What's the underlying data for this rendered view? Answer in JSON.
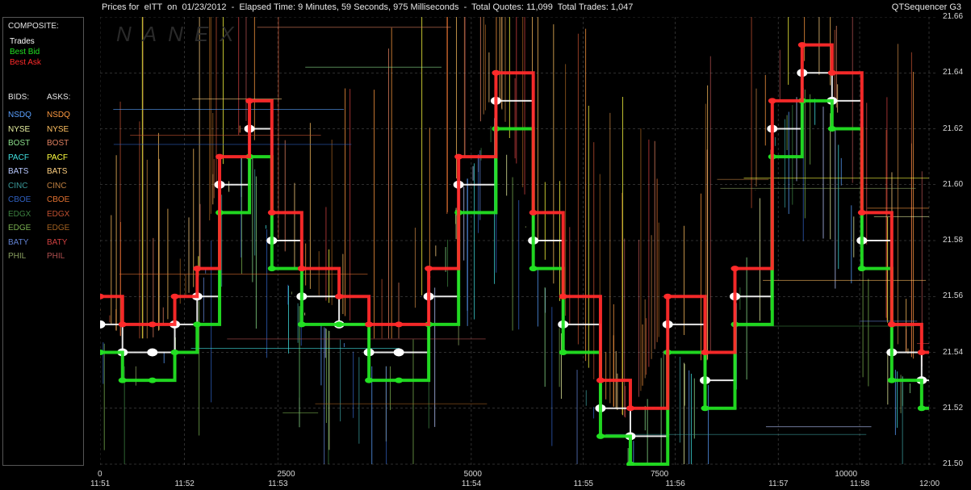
{
  "header": {
    "title": "Prices for  eITT  on  01/23/2012  -  Elapsed Time: 9 Minutes, 59 Seconds, 975 Milliseconds  -  Total Quotes: 11,099  Total Trades: 1,047",
    "app_name": "QTSequencer G3"
  },
  "watermark": "NANEX",
  "legend": {
    "composite_header": "COMPOSITE:",
    "composite": [
      {
        "label": "Trades",
        "color": "#ffffff"
      },
      {
        "label": "Best Bid",
        "color": "#22e022"
      },
      {
        "label": "Best Ask",
        "color": "#ff2a2a"
      }
    ],
    "bids_header": "BIDS:",
    "asks_header": "ASKS:",
    "bids": [
      {
        "label": "NSDQ",
        "color": "#5aa0ff"
      },
      {
        "label": "NYSE",
        "color": "#e8f0a0"
      },
      {
        "label": "BOST",
        "color": "#8ce08c"
      },
      {
        "label": "PACF",
        "color": "#40e0e0"
      },
      {
        "label": "BATS",
        "color": "#b8c8ff"
      },
      {
        "label": "CINC",
        "color": "#3a9a9a"
      },
      {
        "label": "CBOE",
        "color": "#3060c0"
      },
      {
        "label": "EDGX",
        "color": "#3c8040"
      },
      {
        "label": "EDGE",
        "color": "#7ab050"
      },
      {
        "label": "BATY",
        "color": "#6080d0"
      },
      {
        "label": "PHIL",
        "color": "#8aa060"
      }
    ],
    "asks": [
      {
        "label": "NSDQ",
        "color": "#ff9a40"
      },
      {
        "label": "NYSE",
        "color": "#ffc060"
      },
      {
        "label": "BOST",
        "color": "#e08060"
      },
      {
        "label": "PACF",
        "color": "#ffff40"
      },
      {
        "label": "BATS",
        "color": "#ffd080"
      },
      {
        "label": "CINC",
        "color": "#c08040"
      },
      {
        "label": "CBOE",
        "color": "#e07030"
      },
      {
        "label": "EDGX",
        "color": "#c05030"
      },
      {
        "label": "EDGE",
        "color": "#a06020"
      },
      {
        "label": "BATY",
        "color": "#d04040"
      },
      {
        "label": "PHIL",
        "color": "#b05050"
      }
    ]
  },
  "chart_data": {
    "type": "line",
    "y_ticks": [
      "21.66",
      "21.64",
      "21.62",
      "21.60",
      "21.58",
      "21.56",
      "21.54",
      "21.52",
      "21.50"
    ],
    "ylim": [
      21.5,
      21.66
    ],
    "x_seq_ticks": [
      "0",
      "2500",
      "5000",
      "7500",
      "10000"
    ],
    "x_seq_values": [
      0,
      2500,
      5000,
      7500,
      10000
    ],
    "x_seq_range": [
      0,
      11099
    ],
    "x_time_ticks": [
      "11:51",
      "11:52",
      "11:53",
      "11:54",
      "11:55",
      "11:56",
      "11:57",
      "11:58",
      "12:00"
    ],
    "x_time_seq": [
      0,
      1130,
      2380,
      4970,
      6470,
      7700,
      9080,
      10170,
      11099
    ],
    "grid": true,
    "series": [
      {
        "name": "Trades",
        "role": "trades",
        "color": "#ffffff",
        "x": [
          0,
          300,
          700,
          1000,
          1300,
          1600,
          2000,
          2300,
          2700,
          3200,
          3600,
          4000,
          4400,
          4800,
          5300,
          5800,
          6200,
          6700,
          7100,
          7600,
          8100,
          8500,
          9000,
          9400,
          9800,
          10200,
          10600,
          11000
        ],
        "y": [
          21.55,
          21.54,
          21.54,
          21.55,
          21.56,
          21.6,
          21.62,
          21.58,
          21.56,
          21.55,
          21.54,
          21.54,
          21.56,
          21.6,
          21.63,
          21.58,
          21.55,
          21.52,
          21.51,
          21.55,
          21.53,
          21.56,
          21.62,
          21.64,
          21.63,
          21.58,
          21.54,
          21.53
        ]
      },
      {
        "name": "Best Bid",
        "role": "bid",
        "color": "#22e022",
        "x": [
          0,
          300,
          700,
          1000,
          1300,
          1600,
          2000,
          2300,
          2700,
          3200,
          3600,
          4000,
          4400,
          4800,
          5300,
          5800,
          6200,
          6700,
          7100,
          7600,
          8100,
          8500,
          9000,
          9400,
          9800,
          10200,
          10600,
          11000
        ],
        "y": [
          21.54,
          21.53,
          21.53,
          21.54,
          21.55,
          21.59,
          21.61,
          21.57,
          21.55,
          21.55,
          21.53,
          21.53,
          21.55,
          21.59,
          21.62,
          21.57,
          21.54,
          21.51,
          21.5,
          21.54,
          21.52,
          21.55,
          21.61,
          21.63,
          21.62,
          21.57,
          21.53,
          21.52
        ]
      },
      {
        "name": "Best Ask",
        "role": "ask",
        "color": "#ff2a2a",
        "x": [
          0,
          300,
          700,
          1000,
          1300,
          1600,
          2000,
          2300,
          2700,
          3200,
          3600,
          4000,
          4400,
          4800,
          5300,
          5800,
          6200,
          6700,
          7100,
          7600,
          8100,
          8500,
          9000,
          9400,
          9800,
          10200,
          10600,
          11000
        ],
        "y": [
          21.56,
          21.55,
          21.55,
          21.56,
          21.57,
          21.61,
          21.63,
          21.59,
          21.57,
          21.56,
          21.55,
          21.55,
          21.57,
          21.61,
          21.64,
          21.59,
          21.56,
          21.53,
          21.52,
          21.56,
          21.54,
          21.57,
          21.63,
          21.65,
          21.64,
          21.59,
          21.55,
          21.54
        ]
      }
    ]
  }
}
